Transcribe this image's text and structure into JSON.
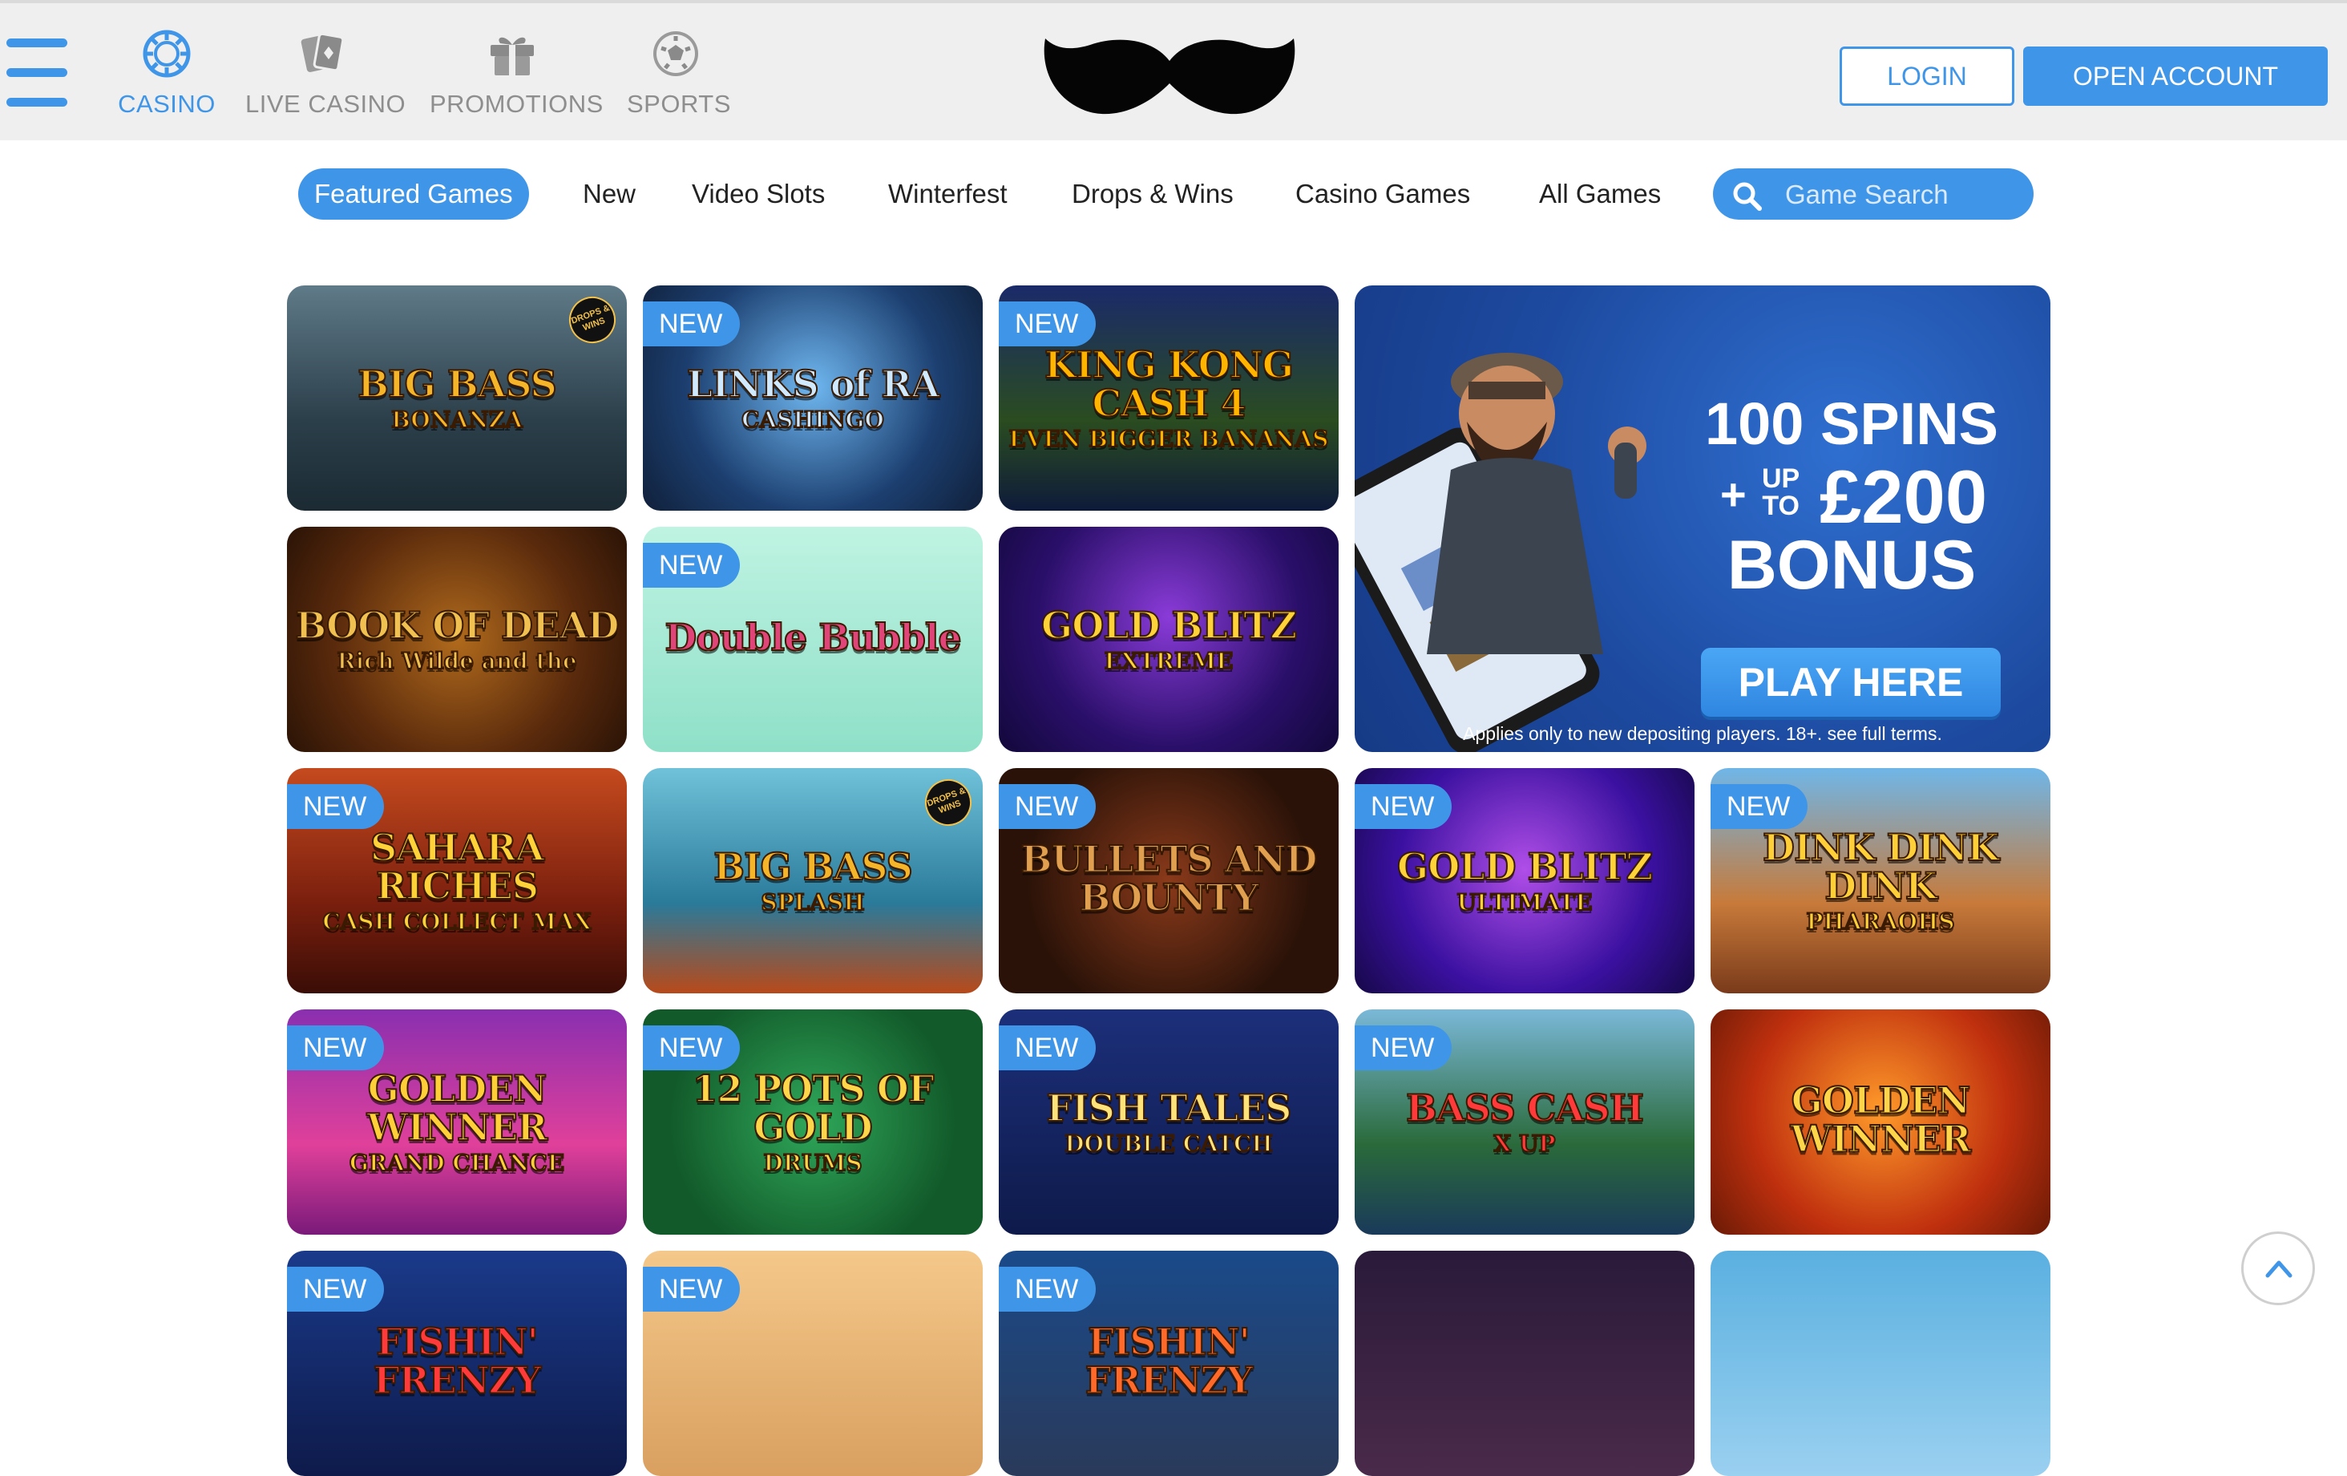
{
  "header": {
    "nav": [
      {
        "label": "CASINO",
        "icon": "casino-chip-icon",
        "active": true
      },
      {
        "label": "LIVE CASINO",
        "icon": "playing-cards-icon",
        "active": false
      },
      {
        "label": "PROMOTIONS",
        "icon": "gift-box-icon",
        "active": false
      },
      {
        "label": "SPORTS",
        "icon": "football-icon",
        "active": false
      }
    ],
    "logo": "mustache-logo-icon",
    "login_label": "LOGIN",
    "open_account_label": "OPEN ACCOUNT"
  },
  "categories": {
    "tabs": [
      "Featured Games",
      "New",
      "Video Slots",
      "Winterfest",
      "Drops & Wins",
      "Casino Games",
      "All Games"
    ],
    "active": "Featured Games",
    "search_placeholder": "Game Search"
  },
  "badge_new": "NEW",
  "drops_badge": "DROPS & WINS",
  "games": [
    {
      "title": "BIG BASS",
      "subtitle": "BONANZA",
      "new": false,
      "drops": true
    },
    {
      "title": "LINKS of RA",
      "subtitle": "CASHINGO",
      "new": true,
      "drops": false
    },
    {
      "title": "KING KONG CASH 4",
      "subtitle": "EVEN BIGGER BANANAS",
      "new": true,
      "drops": false
    },
    {
      "title": "BOOK OF DEAD",
      "subtitle": "Rich Wilde and the",
      "new": false,
      "drops": false
    },
    {
      "title": "Double Bubble",
      "subtitle": "",
      "new": true,
      "drops": false
    },
    {
      "title": "GOLD BLITZ",
      "subtitle": "EXTREME",
      "new": false,
      "drops": false
    },
    {
      "title": "SAHARA RICHES",
      "subtitle": "CASH COLLECT MAX",
      "new": true,
      "drops": false
    },
    {
      "title": "BIG BASS",
      "subtitle": "SPLASH",
      "new": false,
      "drops": true
    },
    {
      "title": "BULLETS AND BOUNTY",
      "subtitle": "",
      "new": true,
      "drops": false
    },
    {
      "title": "GOLD BLITZ",
      "subtitle": "ULTIMATE",
      "new": true,
      "drops": false
    },
    {
      "title": "DINK DINK DINK",
      "subtitle": "PHARAOHS",
      "new": true,
      "drops": false
    },
    {
      "title": "GOLDEN WINNER",
      "subtitle": "GRAND CHANCE",
      "new": true,
      "drops": false
    },
    {
      "title": "12 POTS OF GOLD",
      "subtitle": "DRUMS",
      "new": true,
      "drops": false
    },
    {
      "title": "FISH TALES",
      "subtitle": "DOUBLE CATCH",
      "new": true,
      "drops": false
    },
    {
      "title": "BASS CASH",
      "subtitle": "X UP",
      "new": true,
      "drops": false
    },
    {
      "title": "GOLDEN WINNER",
      "subtitle": "",
      "new": false,
      "drops": false
    },
    {
      "title": "FISHIN' FRENZY",
      "subtitle": "",
      "new": true,
      "drops": false
    },
    {
      "title": "",
      "subtitle": "",
      "new": true,
      "drops": false
    },
    {
      "title": "FISHIN' FRENZY",
      "subtitle": "",
      "new": true,
      "drops": false
    },
    {
      "title": "",
      "subtitle": "",
      "new": false,
      "drops": false
    },
    {
      "title": "",
      "subtitle": "",
      "new": false,
      "drops": false
    }
  ],
  "promo": {
    "line1": "100 SPINS",
    "plus": "+",
    "up": "UP",
    "to": "TO",
    "amount": "£200",
    "line3": "BONUS",
    "cta": "PLAY HERE",
    "terms": "Applies only to new depositing players. 18+. see full terms."
  },
  "colors": {
    "accent": "#3f96e8",
    "header_bg": "#efefef",
    "nav_inactive": "#8e8e8e"
  }
}
